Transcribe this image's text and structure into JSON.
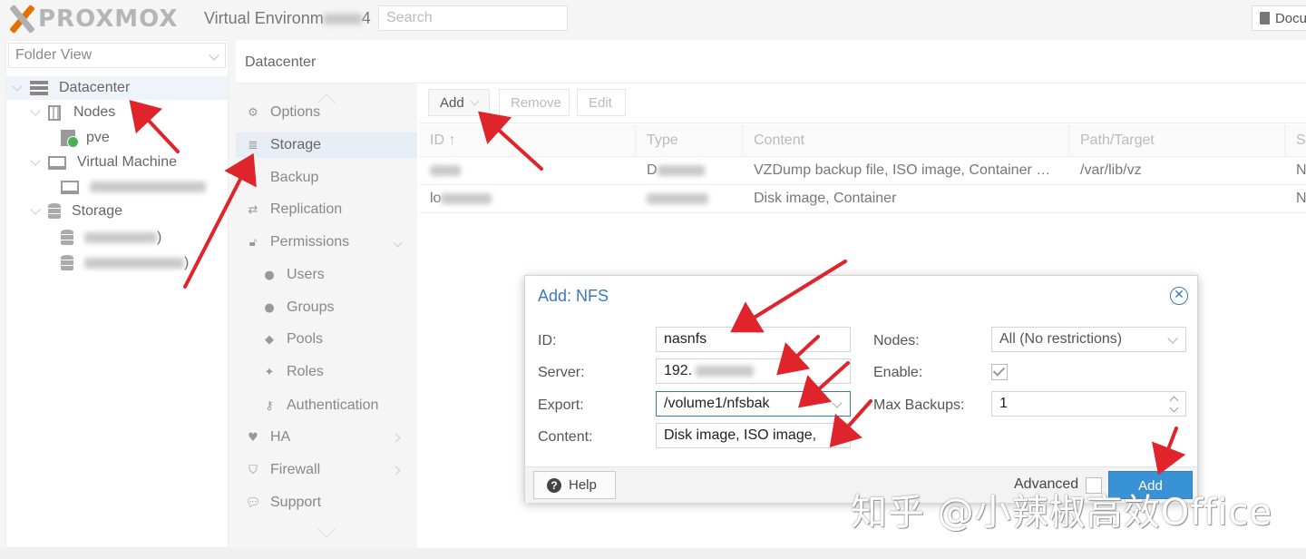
{
  "header": {
    "brand": "PROXMOX",
    "product": "Virtual Environm",
    "version_tail": "4",
    "search_placeholder": "Search",
    "docs_label": "Docu"
  },
  "tree": {
    "view_select": "Folder View",
    "items": [
      {
        "label": "Datacenter"
      },
      {
        "label": "Nodes"
      },
      {
        "label": "pve"
      },
      {
        "label": "Virtual Machine"
      },
      {
        "label": "Storage"
      },
      {
        "label": ")"
      },
      {
        "label": ")"
      }
    ]
  },
  "main": {
    "title": "Datacenter",
    "nav": [
      {
        "label": "Options",
        "icon": "gear-icon"
      },
      {
        "label": "Storage",
        "icon": "database-icon"
      },
      {
        "label": "Backup",
        "icon": "floppy-icon"
      },
      {
        "label": "Replication",
        "icon": "retweet-icon"
      },
      {
        "label": "Permissions",
        "icon": "unlock-icon"
      },
      {
        "label": "Users",
        "icon": "user-icon"
      },
      {
        "label": "Groups",
        "icon": "users-icon"
      },
      {
        "label": "Pools",
        "icon": "tags-icon"
      },
      {
        "label": "Roles",
        "icon": "male-icon"
      },
      {
        "label": "Authentication",
        "icon": "key-icon"
      },
      {
        "label": "HA",
        "icon": "heartbeat-icon"
      },
      {
        "label": "Firewall",
        "icon": "shield-icon"
      },
      {
        "label": "Support",
        "icon": "comments-icon"
      }
    ],
    "toolbar": {
      "add": "Add",
      "remove": "Remove",
      "edit": "Edit"
    },
    "columns": [
      "ID",
      "Type",
      "Content",
      "Path/Target",
      "S"
    ],
    "rows": [
      {
        "id": "",
        "type": "D",
        "content": "VZDump backup file, ISO image, Container t...",
        "path": "/var/lib/vz",
        "shared": "N"
      },
      {
        "id": "lo",
        "type": "",
        "content": "Disk image, Container",
        "path": "",
        "shared": "N"
      }
    ]
  },
  "dialog": {
    "title": "Add: NFS",
    "fields": {
      "id_label": "ID:",
      "id_value": "nasnfs",
      "server_label": "Server:",
      "server_value": "192.",
      "export_label": "Export:",
      "export_value": "/volume1/nfsbak",
      "content_label": "Content:",
      "content_value": "Disk image, ISO image,",
      "nodes_label": "Nodes:",
      "nodes_value": "All (No restrictions)",
      "enable_label": "Enable:",
      "maxbackups_label": "Max Backups:",
      "maxbackups_value": "1"
    },
    "footer": {
      "help": "Help",
      "advanced": "Advanced",
      "add": "Add"
    }
  },
  "watermark": "知乎 @小辣椒高效Office",
  "annotation_color": "#e0242b",
  "accent_color": "#3892d4"
}
